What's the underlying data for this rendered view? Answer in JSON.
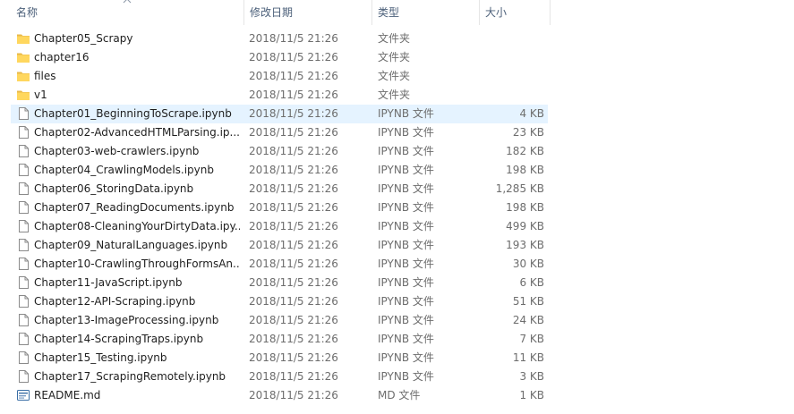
{
  "header": {
    "name_label": "名称",
    "date_label": "修改日期",
    "type_label": "类型",
    "size_label": "大小"
  },
  "files": [
    {
      "name": "Chapter05_Scrapy",
      "date": "2018/11/5 21:26",
      "type": "文件夹",
      "size": "",
      "icon": "folder-icon"
    },
    {
      "name": "chapter16",
      "date": "2018/11/5 21:26",
      "type": "文件夹",
      "size": "",
      "icon": "folder-icon"
    },
    {
      "name": "files",
      "date": "2018/11/5 21:26",
      "type": "文件夹",
      "size": "",
      "icon": "folder-icon"
    },
    {
      "name": "v1",
      "date": "2018/11/5 21:26",
      "type": "文件夹",
      "size": "",
      "icon": "folder-icon"
    },
    {
      "name": "Chapter01_BeginningToScrape.ipynb",
      "date": "2018/11/5 21:26",
      "type": "IPYNB 文件",
      "size": "4 KB",
      "icon": "file-icon",
      "selected": true
    },
    {
      "name": "Chapter02-AdvancedHTMLParsing.ip...",
      "date": "2018/11/5 21:26",
      "type": "IPYNB 文件",
      "size": "23 KB",
      "icon": "file-icon"
    },
    {
      "name": "Chapter03-web-crawlers.ipynb",
      "date": "2018/11/5 21:26",
      "type": "IPYNB 文件",
      "size": "182 KB",
      "icon": "file-icon"
    },
    {
      "name": "Chapter04_CrawlingModels.ipynb",
      "date": "2018/11/5 21:26",
      "type": "IPYNB 文件",
      "size": "198 KB",
      "icon": "file-icon"
    },
    {
      "name": "Chapter06_StoringData.ipynb",
      "date": "2018/11/5 21:26",
      "type": "IPYNB 文件",
      "size": "1,285 KB",
      "icon": "file-icon"
    },
    {
      "name": "Chapter07_ReadingDocuments.ipynb",
      "date": "2018/11/5 21:26",
      "type": "IPYNB 文件",
      "size": "198 KB",
      "icon": "file-icon"
    },
    {
      "name": "Chapter08-CleaningYourDirtyData.ipy...",
      "date": "2018/11/5 21:26",
      "type": "IPYNB 文件",
      "size": "499 KB",
      "icon": "file-icon"
    },
    {
      "name": "Chapter09_NaturalLanguages.ipynb",
      "date": "2018/11/5 21:26",
      "type": "IPYNB 文件",
      "size": "193 KB",
      "icon": "file-icon"
    },
    {
      "name": "Chapter10-CrawlingThroughFormsAn...",
      "date": "2018/11/5 21:26",
      "type": "IPYNB 文件",
      "size": "30 KB",
      "icon": "file-icon"
    },
    {
      "name": "Chapter11-JavaScript.ipynb",
      "date": "2018/11/5 21:26",
      "type": "IPYNB 文件",
      "size": "6 KB",
      "icon": "file-icon"
    },
    {
      "name": "Chapter12-API-Scraping.ipynb",
      "date": "2018/11/5 21:26",
      "type": "IPYNB 文件",
      "size": "51 KB",
      "icon": "file-icon"
    },
    {
      "name": "Chapter13-ImageProcessing.ipynb",
      "date": "2018/11/5 21:26",
      "type": "IPYNB 文件",
      "size": "24 KB",
      "icon": "file-icon"
    },
    {
      "name": "Chapter14-ScrapingTraps.ipynb",
      "date": "2018/11/5 21:26",
      "type": "IPYNB 文件",
      "size": "7 KB",
      "icon": "file-icon"
    },
    {
      "name": "Chapter15_Testing.ipynb",
      "date": "2018/11/5 21:26",
      "type": "IPYNB 文件",
      "size": "11 KB",
      "icon": "file-icon"
    },
    {
      "name": "Chapter17_ScrapingRemotely.ipynb",
      "date": "2018/11/5 21:26",
      "type": "IPYNB 文件",
      "size": "3 KB",
      "icon": "file-icon"
    },
    {
      "name": "README.md",
      "date": "2018/11/5 21:26",
      "type": "MD 文件",
      "size": "1 KB",
      "icon": "md-file-icon"
    }
  ],
  "colors": {
    "selection": "#e5f3ff",
    "folder": "#ffd75e",
    "header_text": "#4c607a",
    "detail_text": "#6d6d6d"
  }
}
